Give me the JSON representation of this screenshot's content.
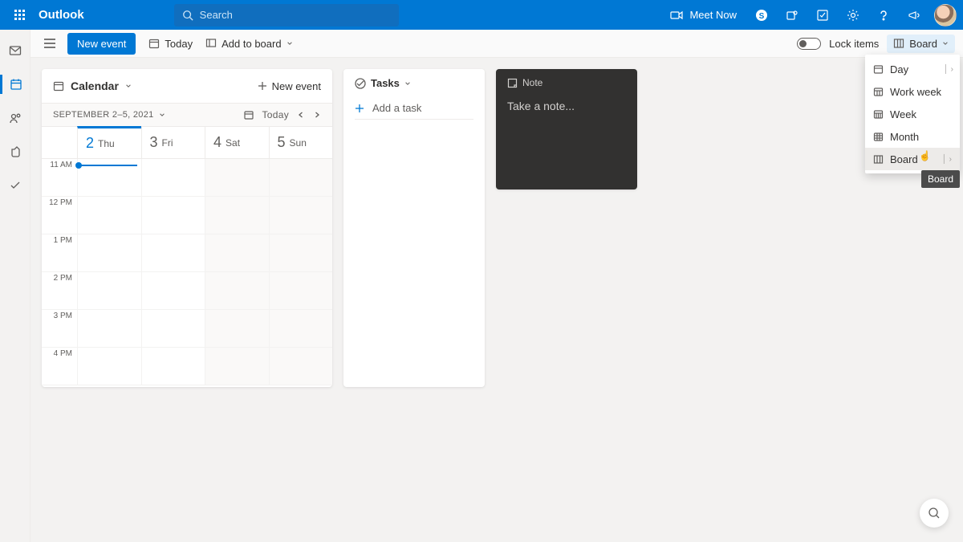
{
  "app": {
    "name": "Outlook"
  },
  "search": {
    "placeholder": "Search"
  },
  "header": {
    "meet_now": "Meet Now"
  },
  "commandbar": {
    "new_event": "New event",
    "today": "Today",
    "add_to_board": "Add to board",
    "lock_items": "Lock items",
    "board": "Board"
  },
  "calendar_widget": {
    "title": "Calendar",
    "new_event": "New event",
    "range": "SEPTEMBER 2–5, 2021",
    "today_btn": "Today",
    "days": [
      {
        "num": "2",
        "dow": "Thu",
        "today": true
      },
      {
        "num": "3",
        "dow": "Fri",
        "today": false
      },
      {
        "num": "4",
        "dow": "Sat",
        "today": false
      },
      {
        "num": "5",
        "dow": "Sun",
        "today": false
      }
    ],
    "hours": [
      "11 AM",
      "12 PM",
      "1 PM",
      "2 PM",
      "3 PM",
      "4 PM"
    ]
  },
  "tasks_widget": {
    "title": "Tasks",
    "add_task": "Add a task"
  },
  "note_widget": {
    "title": "Note",
    "placeholder": "Take a note..."
  },
  "view_menu": {
    "items": [
      {
        "label": "Day",
        "chevron": true
      },
      {
        "label": "Work week",
        "chevron": false
      },
      {
        "label": "Week",
        "chevron": false
      },
      {
        "label": "Month",
        "chevron": false
      },
      {
        "label": "Board",
        "chevron": true,
        "selected": true
      }
    ],
    "tooltip": "Board"
  }
}
